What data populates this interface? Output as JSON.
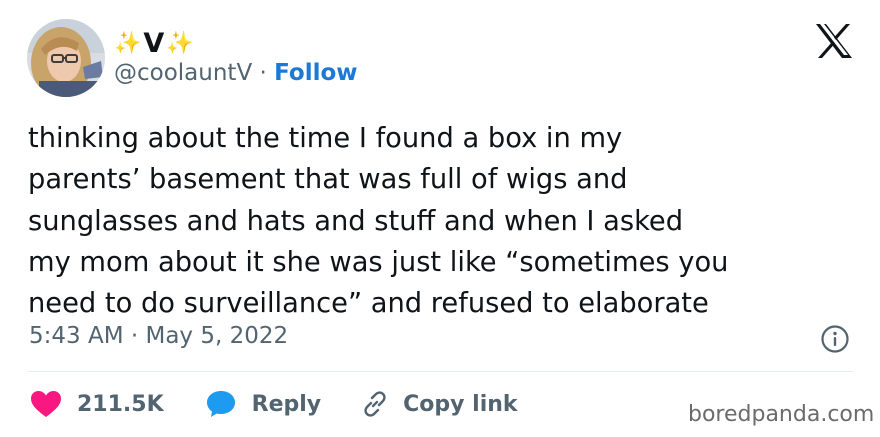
{
  "author": {
    "display_name_sparkle_left": "✨",
    "display_name_core": "V",
    "display_name_sparkle_right": "✨",
    "handle": "@coolauntV",
    "separator": " · ",
    "follow_label": "Follow"
  },
  "tweet": {
    "lines": [
      "thinking about the time I found a box in my",
      "parents’ basement that was full of wigs and",
      "sunglasses and hats and stuff and when I asked",
      "my mom about it she was just like “sometimes you",
      "need to do surveillance” and refused to elaborate"
    ],
    "time": "5:43 AM",
    "separator": " · ",
    "date": "May 5, 2022"
  },
  "actions": {
    "like_count": "211.5K",
    "reply_label": "Reply",
    "copy_label": "Copy link"
  },
  "icons": {
    "platform": "x-logo-icon",
    "info": "info-icon",
    "like": "heart-icon",
    "reply": "speech-bubble-icon",
    "copy": "link-icon"
  },
  "colors": {
    "follow": "#1d79d2",
    "heart": "#f91880",
    "reply": "#1d9bf0",
    "secondary_text": "#536471"
  },
  "watermark": "boredpanda.com"
}
